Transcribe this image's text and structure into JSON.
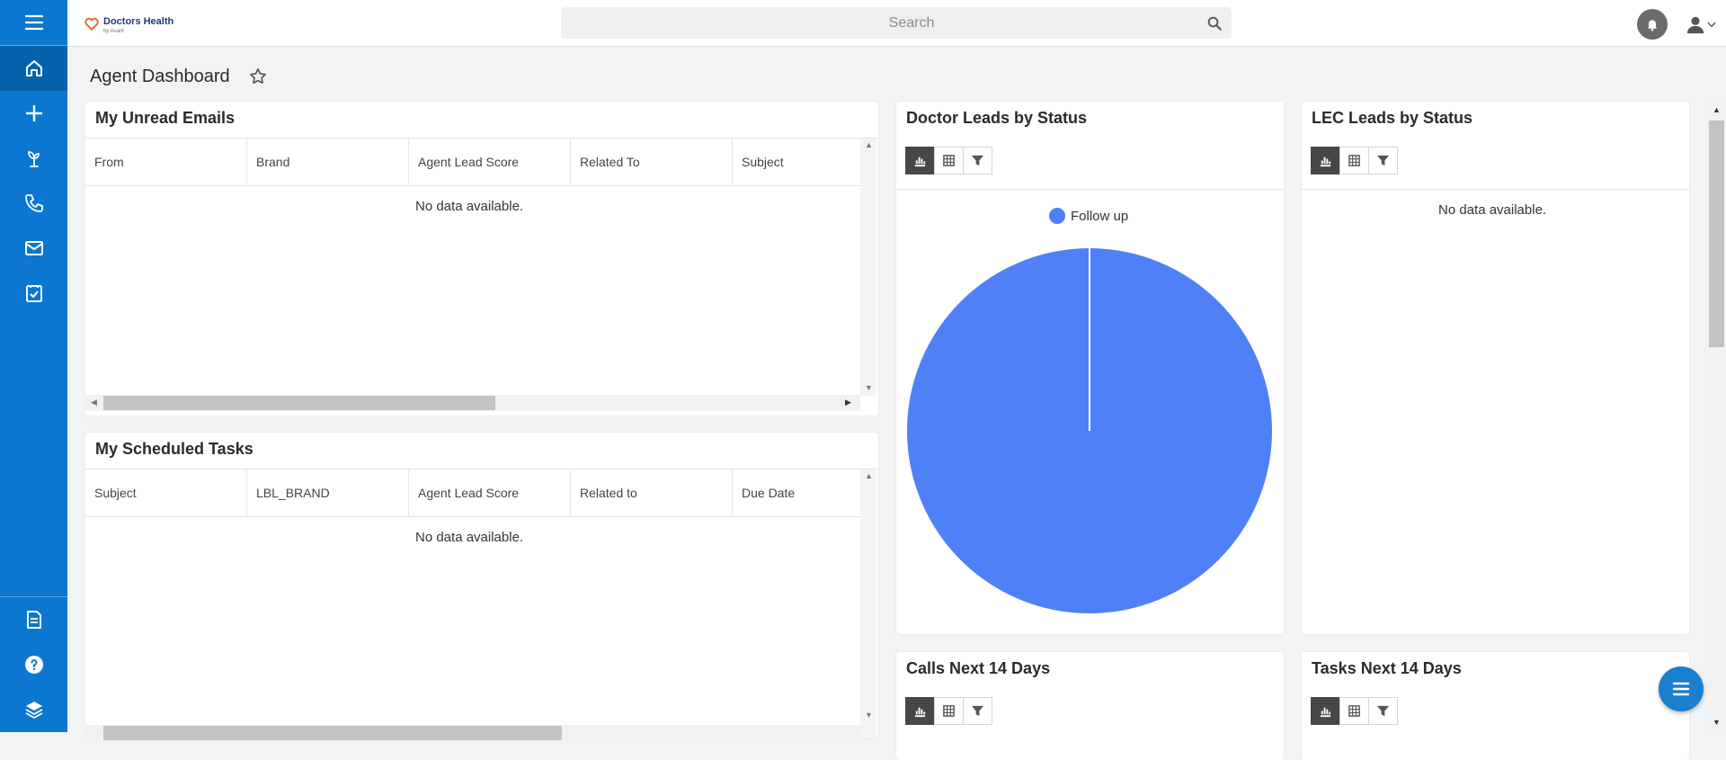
{
  "app": {
    "logo_text": "Doctors Health",
    "logo_sub": "by Avant"
  },
  "search": {
    "placeholder": "Search"
  },
  "page": {
    "title": "Agent Dashboard"
  },
  "unread_emails": {
    "title": "My Unread Emails",
    "columns": [
      "From",
      "Brand",
      "Agent Lead Score",
      "Related To",
      "Subject"
    ],
    "empty_text": "No data available."
  },
  "scheduled_tasks": {
    "title": "My Scheduled Tasks",
    "columns": [
      "Subject",
      "LBL_BRAND",
      "Agent Lead Score",
      "Related to",
      "Due Date"
    ],
    "empty_text": "No data available."
  },
  "doctor_leads": {
    "title": "Doctor Leads by Status",
    "legend": "Follow up",
    "color": "#5080f7"
  },
  "lec_leads": {
    "title": "LEC Leads by Status",
    "empty_text": "No data available."
  },
  "calls": {
    "title": "Calls Next 14 Days"
  },
  "tasks14": {
    "title": "Tasks Next 14 Days"
  },
  "chart_data": {
    "type": "pie",
    "labels": [
      "Follow up"
    ],
    "values": [
      100
    ],
    "colors": [
      "#5080f7"
    ],
    "title": "Doctor Leads by Status",
    "legend": "top"
  },
  "colors": {
    "sidebar": "#0b77d0",
    "sidebar_active": "#0762ad",
    "accent": "#1a7fcf",
    "pie": "#5080f7"
  },
  "icons": {
    "sidebar": [
      "menu-icon",
      "home-icon",
      "plus-icon",
      "plant-icon",
      "phone-icon",
      "mail-icon",
      "task-icon",
      "document-icon",
      "help-icon",
      "layers-icon"
    ],
    "topbar": [
      "search-icon",
      "bell-icon",
      "user-icon",
      "chevron-down-icon"
    ],
    "view": [
      "bar-chart-icon",
      "table-icon",
      "filter-icon"
    ]
  }
}
